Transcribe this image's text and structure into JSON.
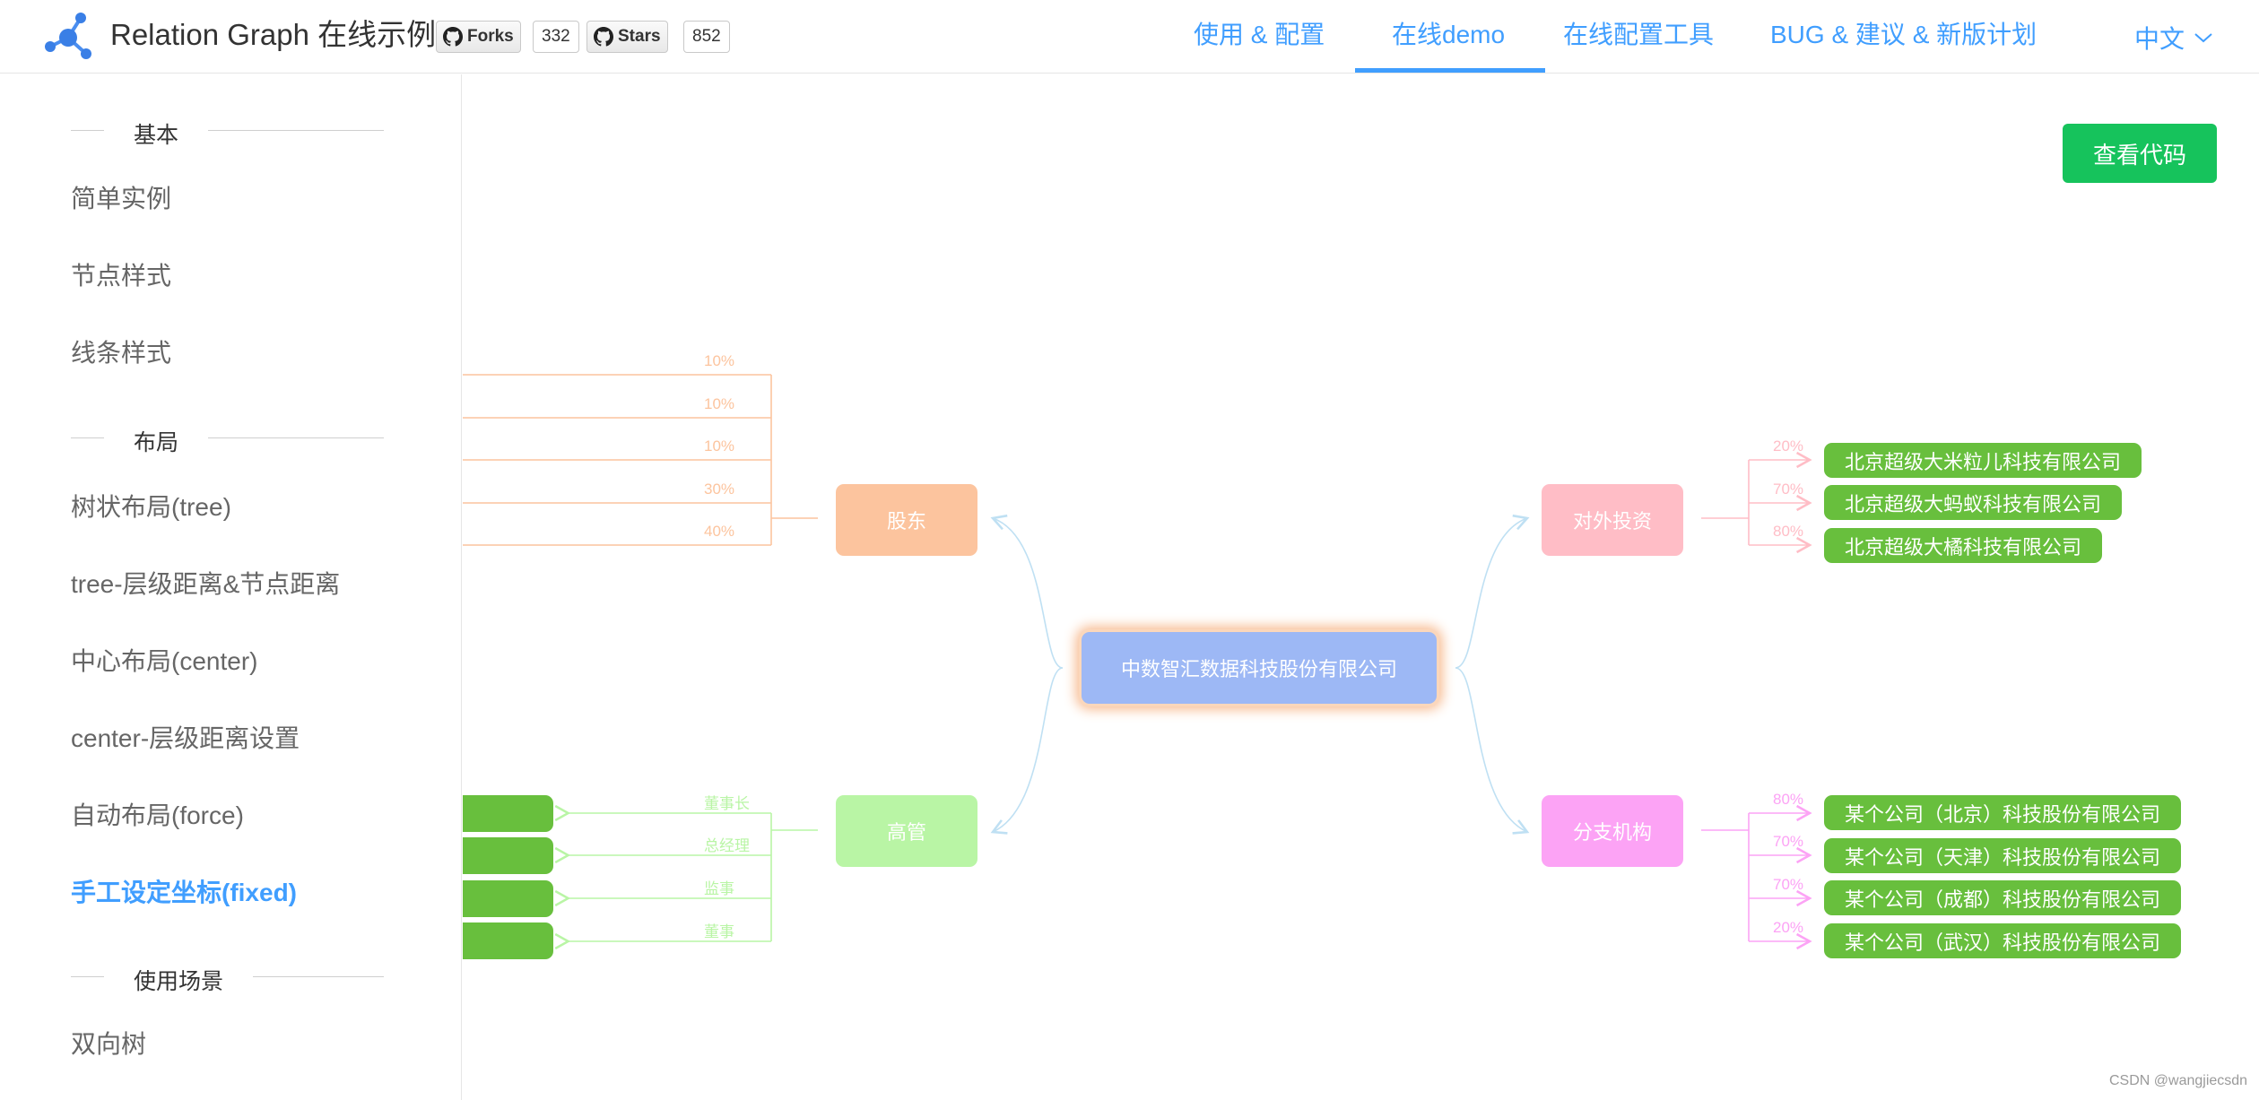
{
  "header": {
    "title": "Relation Graph 在线示例",
    "forks_label": "Forks",
    "forks_count": "332",
    "stars_label": "Stars",
    "stars_count": "852",
    "nav": [
      "使用 & 配置",
      "在线demo",
      "在线配置工具",
      "BUG & 建议 & 新版计划"
    ],
    "active_nav": "在线demo",
    "language": "中文"
  },
  "sidebar": {
    "groups": [
      "基本",
      "布局",
      "使用场景"
    ],
    "items": [
      "简单实例",
      "节点样式",
      "线条样式",
      "树状布局(tree)",
      "tree-层级距离&节点距离",
      "中心布局(center)",
      "center-层级距离设置",
      "自动布局(force)",
      "手工设定坐标(fixed)",
      "双向树"
    ],
    "active_item": "手工设定坐标(fixed)"
  },
  "toolbar": {
    "view_code": "查看代码"
  },
  "graph": {
    "center": "中数智汇数据科技股份有限公司",
    "shareholders": {
      "label": "股东",
      "edge_labels": [
        "10%",
        "10%",
        "10%",
        "30%",
        "40%"
      ]
    },
    "executives": {
      "label": "高管",
      "edge_labels": [
        "董事长",
        "总经理",
        "监事",
        "董事"
      ]
    },
    "investments": {
      "label": "对外投资",
      "edge_labels": [
        "20%",
        "70%",
        "80%"
      ],
      "children": [
        "北京超级大米粒儿科技有限公司",
        "北京超级大蚂蚁科技有限公司",
        "北京超级大橘科技有限公司"
      ]
    },
    "branches": {
      "label": "分支机构",
      "edge_labels": [
        "80%",
        "70%",
        "70%",
        "20%"
      ],
      "children": [
        "某个公司（北京）科技股份有限公司",
        "某个公司（天津）科技股份有限公司",
        "某个公司（成都）科技股份有限公司",
        "某个公司（武汉）科技股份有限公司"
      ]
    },
    "colors": {
      "shareholders": "#fcc49e",
      "executives": "#b9f5a5",
      "investments": "#ffbdc6",
      "branches": "#fca3f5",
      "center": "#9db8f5",
      "leaf": "#68bf3d",
      "link_center": "#bfe0f3"
    }
  },
  "watermark": "CSDN @wangjiecsdn"
}
